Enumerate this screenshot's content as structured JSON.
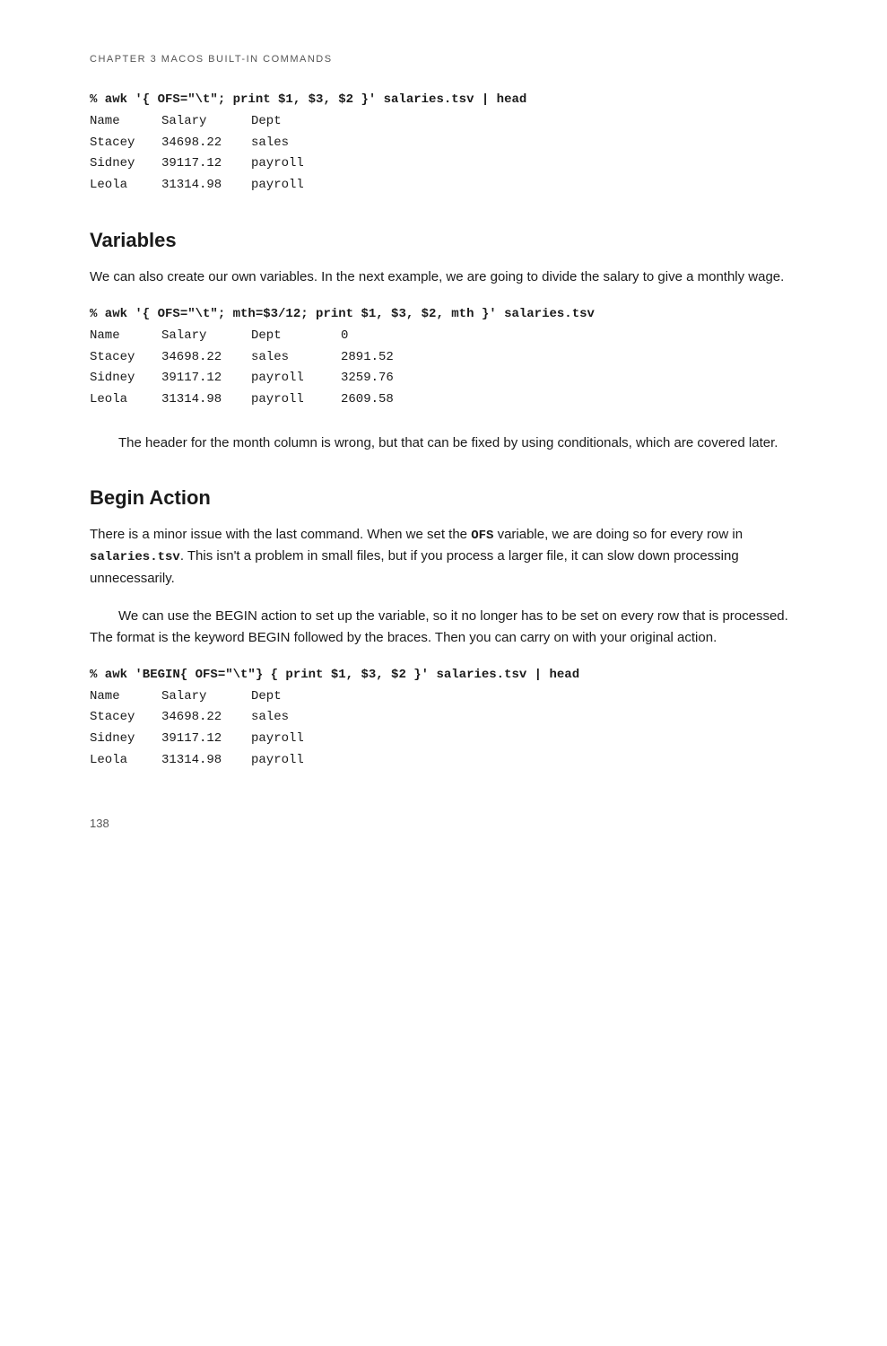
{
  "chapter_header": "CHAPTER 3    MACOS BUILT-IN COMMANDS",
  "code_block_1": {
    "cmd": "% awk '{ OFS=\"\\t\"; print $1, $3, $2 }' salaries.tsv | head",
    "rows": [
      {
        "c1": "Name",
        "c2": "Salary",
        "c3": "Dept"
      },
      {
        "c1": "Stacey",
        "c2": "34698.22",
        "c3": "sales"
      },
      {
        "c1": "Sidney",
        "c2": "39117.12",
        "c3": "payroll"
      },
      {
        "c1": "Leola",
        "c2": "31314.98",
        "c3": "payroll"
      }
    ]
  },
  "section_variables": {
    "title": "Variables",
    "body": "We can also create our own variables. In the next example, we are going to divide the salary to give a monthly wage."
  },
  "code_block_2": {
    "cmd": "% awk '{ OFS=\"\\t\"; mth=$3/12; print $1, $3, $2, mth }' salaries.tsv",
    "rows": [
      {
        "c1": "Name",
        "c2": "Salary",
        "c3": "Dept",
        "c4": "0"
      },
      {
        "c1": "Stacey",
        "c2": "34698.22",
        "c3": "sales",
        "c4": "2891.52"
      },
      {
        "c1": "Sidney",
        "c2": "39117.12",
        "c3": "payroll",
        "c4": "3259.76"
      },
      {
        "c1": "Leola",
        "c2": "31314.98",
        "c3": "payroll",
        "c4": "2609.58"
      }
    ]
  },
  "text_after_code2": "The header for the month column is wrong, but that can be fixed by using conditionals, which are covered later.",
  "section_begin": {
    "title": "Begin Action",
    "body1": "There is a minor issue with the last command. When we set the OFS variable, we are doing so for every row in salaries.tsv. This isn’t a problem in small files, but if you process a larger file, it can slow down processing unnecessarily.",
    "body2_prefix": "We can use the ",
    "body2_code1": "BEGIN",
    "body2_mid": " action to set up the variable, so it no longer has to be set on every row that is processed. The format is the keyword ",
    "body2_code2": "BEGIN",
    "body2_suffix": " followed by the braces. Then you can carry on with your original action."
  },
  "code_block_3": {
    "cmd": "% awk 'BEGIN{ OFS=\"\\t\"} { print $1, $3, $2 }' salaries.tsv | head",
    "rows": [
      {
        "c1": "Name",
        "c2": "Salary",
        "c3": "Dept"
      },
      {
        "c1": "Stacey",
        "c2": "34698.22",
        "c3": "sales"
      },
      {
        "c1": "Sidney",
        "c2": "39117.12",
        "c3": "payroll"
      },
      {
        "c1": "Leola",
        "c2": "31314.98",
        "c3": "payroll"
      }
    ]
  },
  "page_number": "138"
}
